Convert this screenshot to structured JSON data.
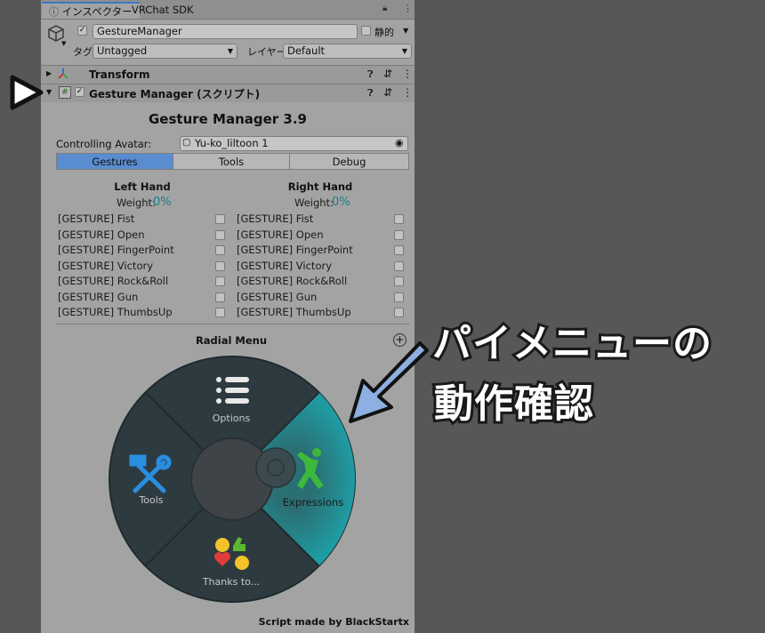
{
  "tabs": [
    {
      "label": "インスペクター"
    },
    {
      "label": "VRChat SDK"
    }
  ],
  "object": {
    "name": "GestureManager",
    "static_label": "静的",
    "tag_label": "タグ",
    "tag_value": "Untagged",
    "layer_label": "レイヤー",
    "layer_value": "Default"
  },
  "components": {
    "transform": "Transform",
    "gesture_manager": "Gesture Manager (スクリプト)"
  },
  "title": "Gesture Manager 3.9",
  "avatar": {
    "label": "Controlling Avatar:",
    "value": "Yu-ko_liltoon 1"
  },
  "mode_tabs": [
    {
      "label": "Gestures"
    },
    {
      "label": "Tools"
    },
    {
      "label": "Debug"
    }
  ],
  "left_hand": {
    "title": "Left Hand",
    "weight_label": "Weight:",
    "weight_value": "0%"
  },
  "right_hand": {
    "title": "Right Hand",
    "weight_label": "Weight:",
    "weight_value": "0%"
  },
  "gestures": [
    "[GESTURE] Fist",
    "[GESTURE] Open",
    "[GESTURE] FingerPoint",
    "[GESTURE] Victory",
    "[GESTURE] Rock&Roll",
    "[GESTURE] Gun",
    "[GESTURE] ThumbsUp"
  ],
  "radial": {
    "title": "Radial Menu",
    "options": "Options",
    "tools": "Tools",
    "expressions": "Expressions",
    "thanks": "Thanks to..."
  },
  "footer": "Script made by BlackStartx",
  "annotation": {
    "line1": "パイメニューの",
    "line2": "動作確認"
  },
  "colors": {
    "accent_blue": "#5a8cd0",
    "teal": "#1d7c88",
    "annotation_arrow": "#8db0e0"
  }
}
